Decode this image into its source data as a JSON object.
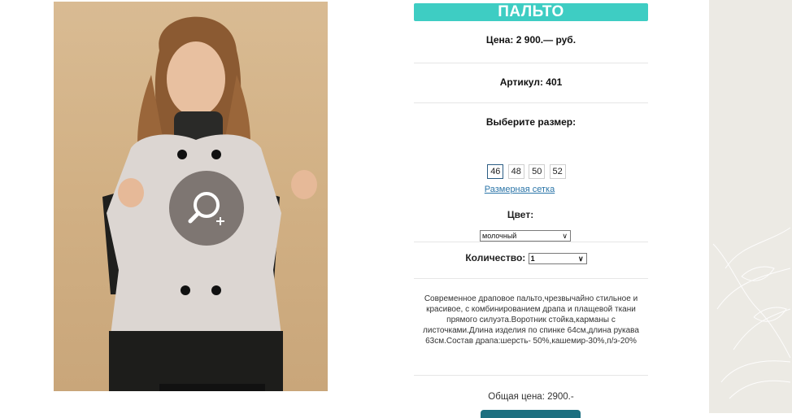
{
  "product": {
    "title": "ПАЛЬТО",
    "price": "Цена: 2 900.— руб.",
    "sku": "Артикул: 401",
    "size_label": "Выберите размер:",
    "sizes": [
      "46",
      "48",
      "50",
      "52"
    ],
    "selected_size": "46",
    "size_chart_link": "Размерная сетка",
    "color_label": "Цвет:",
    "color_value": "молочный",
    "quantity_label": "Количество:",
    "quantity_value": "1",
    "description": "Современное драповое пальто,чрезвычайно стильное и красивое, с комбинированием драпа и плащевой ткани прямого силуэта.Воротник стойка,карманы с листочками.Длина изделия по спинке 64см,длина рукава 63см.Состав драпа:шерсть- 50%,кашемир-30%,п/э-20%",
    "total_price": "Общая цена: 2900.-"
  },
  "icons": {
    "zoom": "zoom-in-icon",
    "select": "chevron-down-icon"
  },
  "colors": {
    "accent": "#3ecdc3",
    "link": "#2b75a8",
    "button": "#1c6f80"
  }
}
